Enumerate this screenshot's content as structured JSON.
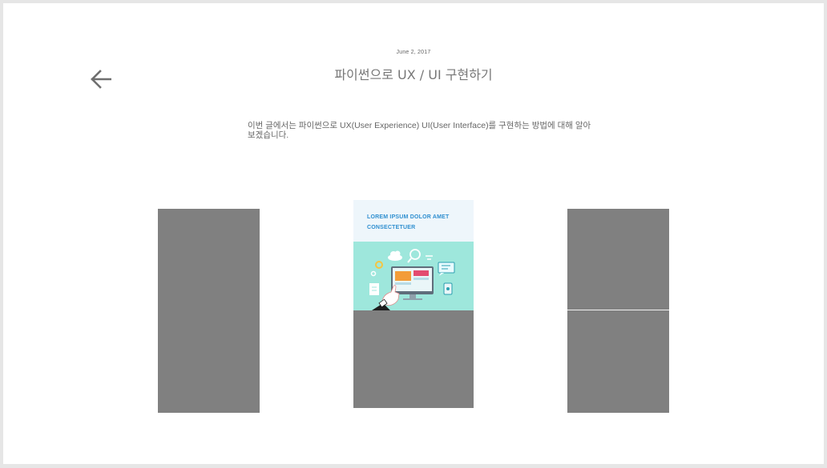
{
  "post": {
    "date": "June 2, 2017",
    "title": "파이썬으로 UX / UI 구현하기",
    "description": "이번 글에서는 파이썬으로 UX(User Experience) UI(User Interface)를 구현하는 방법에 대해 알아보겠습니다."
  },
  "card": {
    "heading_line1": "LOREM IPSUM DOLOR AMET",
    "heading_line2": "CONSECTETUER"
  },
  "icons": {
    "back": "arrow-left-icon",
    "illustration": "computer-touch-illustration"
  },
  "colors": {
    "background": "#ffffff",
    "frame": "#e6e6e6",
    "placeholder": "#808080",
    "card_header_bg": "#eef6fb",
    "card_heading": "#2f8fd0",
    "illustration_bg": "#9ee7dc"
  }
}
